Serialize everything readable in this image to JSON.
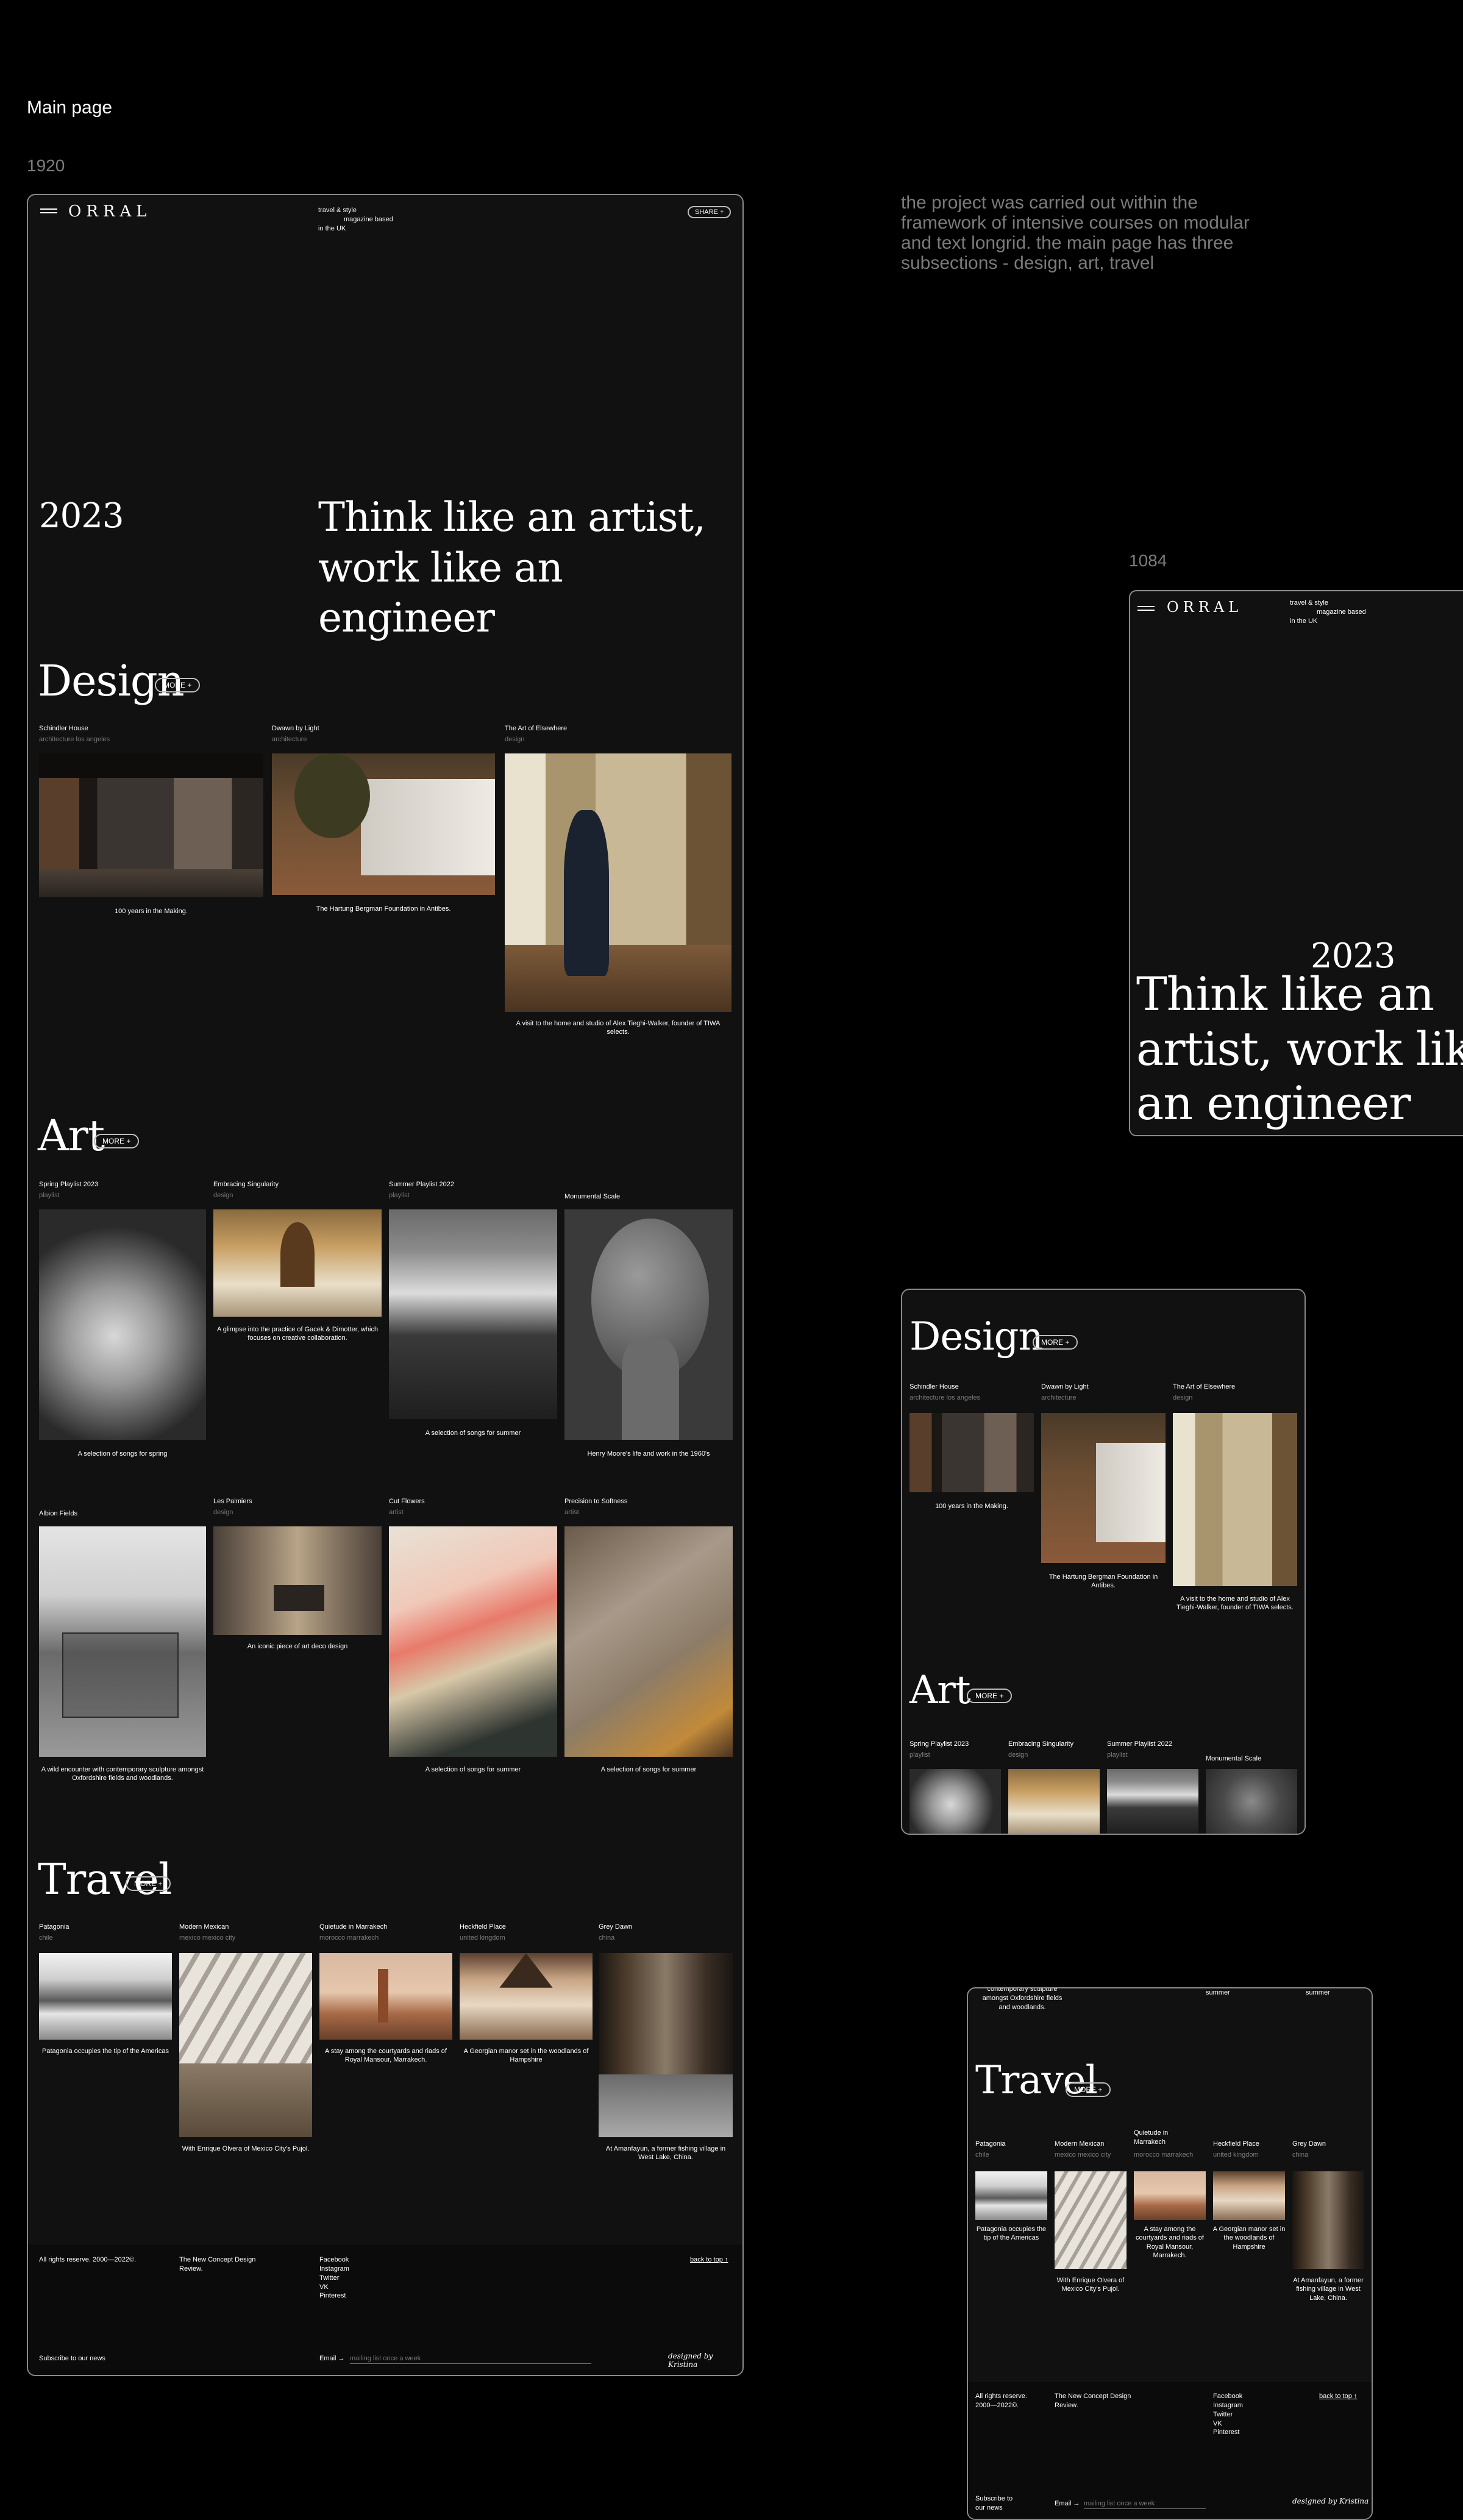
{
  "page": {
    "heading": "Main page",
    "size_label_1920": "1920",
    "size_label_1084": "1084",
    "description": "the project was carried out within the framework of intensive courses on modular and text longrid. the main page has three subsections - design, art, travel"
  },
  "header": {
    "logo": "ORRAL",
    "tagline_1": "travel & style",
    "tagline_2": "magazine based",
    "tagline_3": "in the UK",
    "share_label": "SHARE +"
  },
  "hero": {
    "year": "2023",
    "title": "Think like an artist, work like an engineer"
  },
  "sections": {
    "more_label": "MORE +",
    "design_title": "Design",
    "art_title": "Art",
    "travel_title": "Travel"
  },
  "design_cards": [
    {
      "title": "Schindler House",
      "tag": "architecture los angeles",
      "caption": "100 years in the Making."
    },
    {
      "title": "Dwawn by Light",
      "tag": "architecture",
      "caption": "The Hartung Bergman Foundation in Antibes."
    },
    {
      "title": "The Art of Elsewhere",
      "tag": "design",
      "caption": "A visit to the home and studio of Alex Tieghi-Walker, founder of TIWA selects."
    }
  ],
  "art_cards": [
    {
      "title": "Spring Playlist 2023",
      "tag": "playlist",
      "caption": "A selection of songs for spring"
    },
    {
      "title": "Embracing Singularity",
      "tag": "design",
      "caption": "A glimpse into the practice of Gacek & Dimotter, which focuses on creative collaboration."
    },
    {
      "title": "Summer Playlist 2022",
      "tag": "playlist",
      "caption": "A selection of songs for summer"
    },
    {
      "title": "Monumental Scale",
      "tag": "",
      "caption": "Henry Moore's life and work in the 1960's"
    },
    {
      "title": "Albion Fields",
      "tag": "",
      "caption": "A wild encounter with contemporary sculpture amongst Oxfordshire fields and woodlands."
    },
    {
      "title": "Les Palmiers",
      "tag": "design",
      "caption": "An iconic piece of art deco design"
    },
    {
      "title": "Cut Flowers",
      "tag": "artist",
      "caption": "A selection of songs for summer"
    },
    {
      "title": "Precision to Softness",
      "tag": "artist",
      "caption": "A selection of songs for summer"
    }
  ],
  "travel_cards": [
    {
      "title": "Patagonia",
      "tag": "chile",
      "caption": "Patagonia occupies the tip of the Americas"
    },
    {
      "title": "Modern Mexican",
      "tag": "mexico mexico city",
      "caption": "With Enrique Olvera of Mexico City's Pujol."
    },
    {
      "title": "Quietude in Marrakech",
      "tag": "morocco marrakech",
      "caption": "A stay among the courtyards and riads of Royal Mansour, Marrakech."
    },
    {
      "title": "Heckfield Place",
      "tag": "united kingdom",
      "caption": "A Georgian manor set in the woodlands of Hampshire"
    },
    {
      "title": "Grey Dawn",
      "tag": "china",
      "caption": "At Amanfayun, a former fishing village in West Lake, China."
    }
  ],
  "footer": {
    "rights": "All rights reserve. 2000—2022©.",
    "review": "The New Concept Design Review.",
    "links": [
      "Facebook",
      "Instagram",
      "Twitter",
      "VK",
      "Pinterest"
    ],
    "back_to_top": "back to top ↑",
    "subscribe": "Subscribe to our news",
    "email_label": "Email →",
    "email_placeholder": "mailing list once a week",
    "signature": "designed by Kristina"
  },
  "tablet": {
    "quietude_title": "Quietude in Marrakech",
    "albion_caption_partial": "contemporary sculpture amongst Oxfordshire fields and woodlands.",
    "summer_partial": "summer",
    "footer_rights": "All rights reserve. 2000—2022©.",
    "subscribe": "Subscribe to our news"
  },
  "colors": {
    "bg": "#000000",
    "panel": "#111111",
    "border": "#8a8a8a",
    "muted": "#7b7b7b"
  }
}
